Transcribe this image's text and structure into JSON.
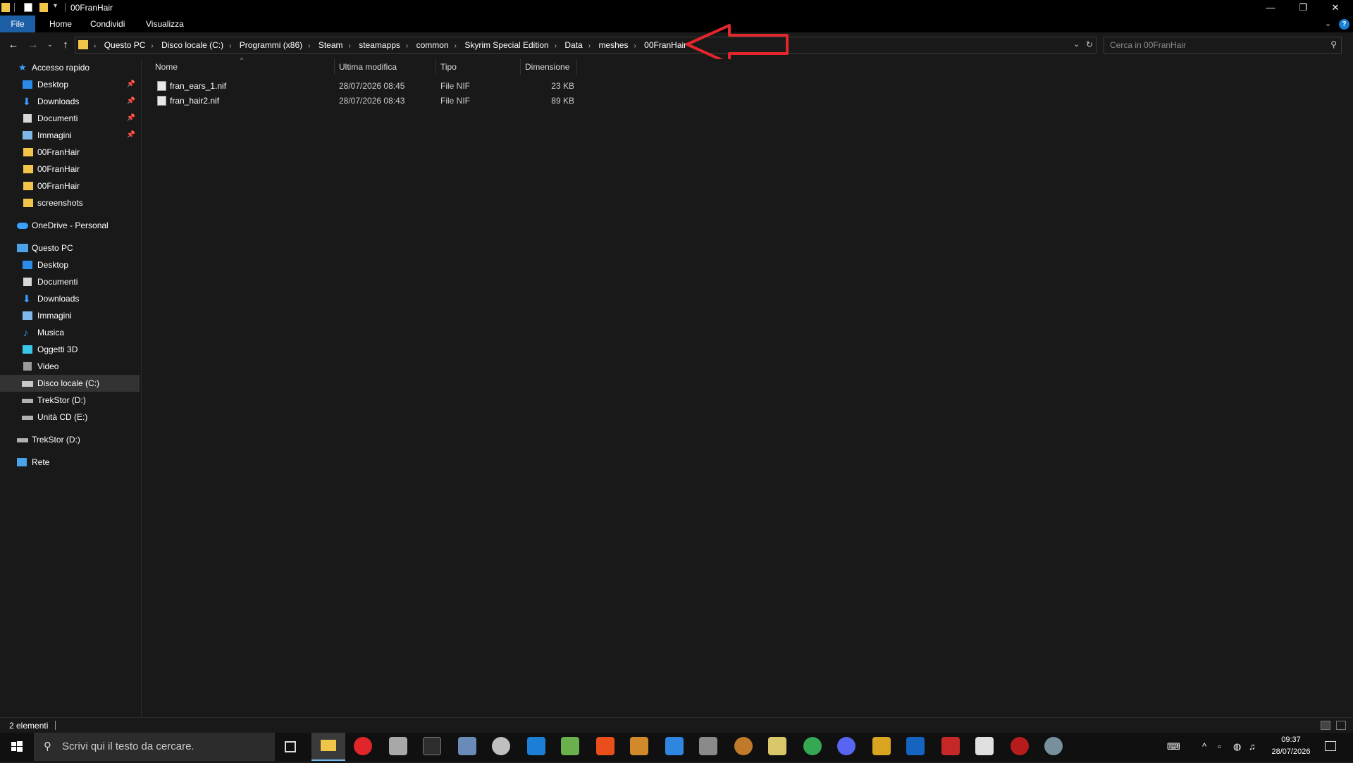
{
  "window": {
    "title": "00FranHair",
    "minimize": "—",
    "maximize": "❐",
    "close": "✕"
  },
  "ribbon": {
    "tabs": [
      "File",
      "Home",
      "Condividi",
      "Visualizza"
    ]
  },
  "address": {
    "crumbs": [
      "Questo PC",
      "Disco locale (C:)",
      "Programmi (x86)",
      "Steam",
      "steamapps",
      "common",
      "Skyrim Special Edition",
      "Data",
      "meshes",
      "00FranHair"
    ]
  },
  "search": {
    "placeholder": "Cerca in 00FranHair"
  },
  "sidebar": {
    "quick_access": "Accesso rapido",
    "quick_items": [
      "Desktop",
      "Downloads",
      "Documenti",
      "Immagini",
      "00FranHair",
      "00FranHair",
      "00FranHair",
      "screenshots"
    ],
    "onedrive": "OneDrive - Personal",
    "this_pc": "Questo PC",
    "pc_items": [
      "Desktop",
      "Documenti",
      "Downloads",
      "Immagini",
      "Musica",
      "Oggetti 3D",
      "Video",
      "Disco locale (C:)",
      "TrekStor (D:)",
      "Unità CD (E:)"
    ],
    "trekstor": "TrekStor (D:)",
    "network": "Rete"
  },
  "columns": {
    "name": "Nome",
    "modified": "Ultima modifica",
    "type": "Tipo",
    "size": "Dimensione"
  },
  "files": [
    {
      "name": "fran_ears_1.nif",
      "modified": "28/07/2026 08:45",
      "type": "File NIF",
      "size": "23 KB"
    },
    {
      "name": "fran_hair2.nif",
      "modified": "28/07/2026 08:43",
      "type": "File NIF",
      "size": "89 KB"
    }
  ],
  "status": {
    "count": "2 elementi"
  },
  "taskbar": {
    "search_placeholder": "Scrivi qui il testo da cercare.",
    "time": "09:37",
    "date": "28/07/2026"
  },
  "colors": {
    "accent": "#1c5fa6",
    "annotation_arrow": "#e3262b"
  }
}
